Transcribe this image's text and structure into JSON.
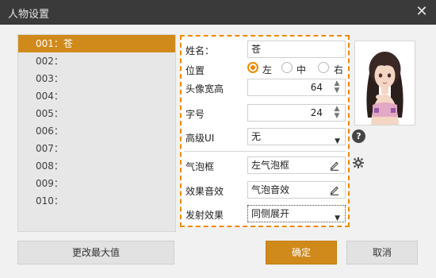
{
  "window": {
    "title": "人物设置"
  },
  "list": {
    "items": [
      "001：苍",
      "002：",
      "003：",
      "004：",
      "005：",
      "006：",
      "007：",
      "008：",
      "009：",
      "010："
    ],
    "selected_index": 0
  },
  "form": {
    "name_label": "姓名：",
    "name_value": "苍",
    "position_label": "位置",
    "position_options": [
      "左",
      "中",
      "右"
    ],
    "position_selected": "左",
    "head_size_label": "头像宽高",
    "head_size_value": "64",
    "font_size_label": "字号",
    "font_size_value": "24",
    "advanced_ui_label": "高级UI",
    "advanced_ui_value": "无",
    "bubble_label": "气泡框",
    "bubble_value": "左气泡框",
    "sound_label": "效果音效",
    "sound_value": "气泡音效",
    "emit_label": "发射效果",
    "emit_value": "同侧展开"
  },
  "buttons": {
    "change_max": "更改最大值",
    "ok": "确定",
    "cancel": "取消"
  },
  "colors": {
    "accent": "#d08a1b",
    "dashed_border": "#f08a00"
  },
  "icons": {
    "close": "close-icon",
    "help": "help-icon",
    "settings": "gear-icon",
    "edit": "pencil-icon"
  }
}
